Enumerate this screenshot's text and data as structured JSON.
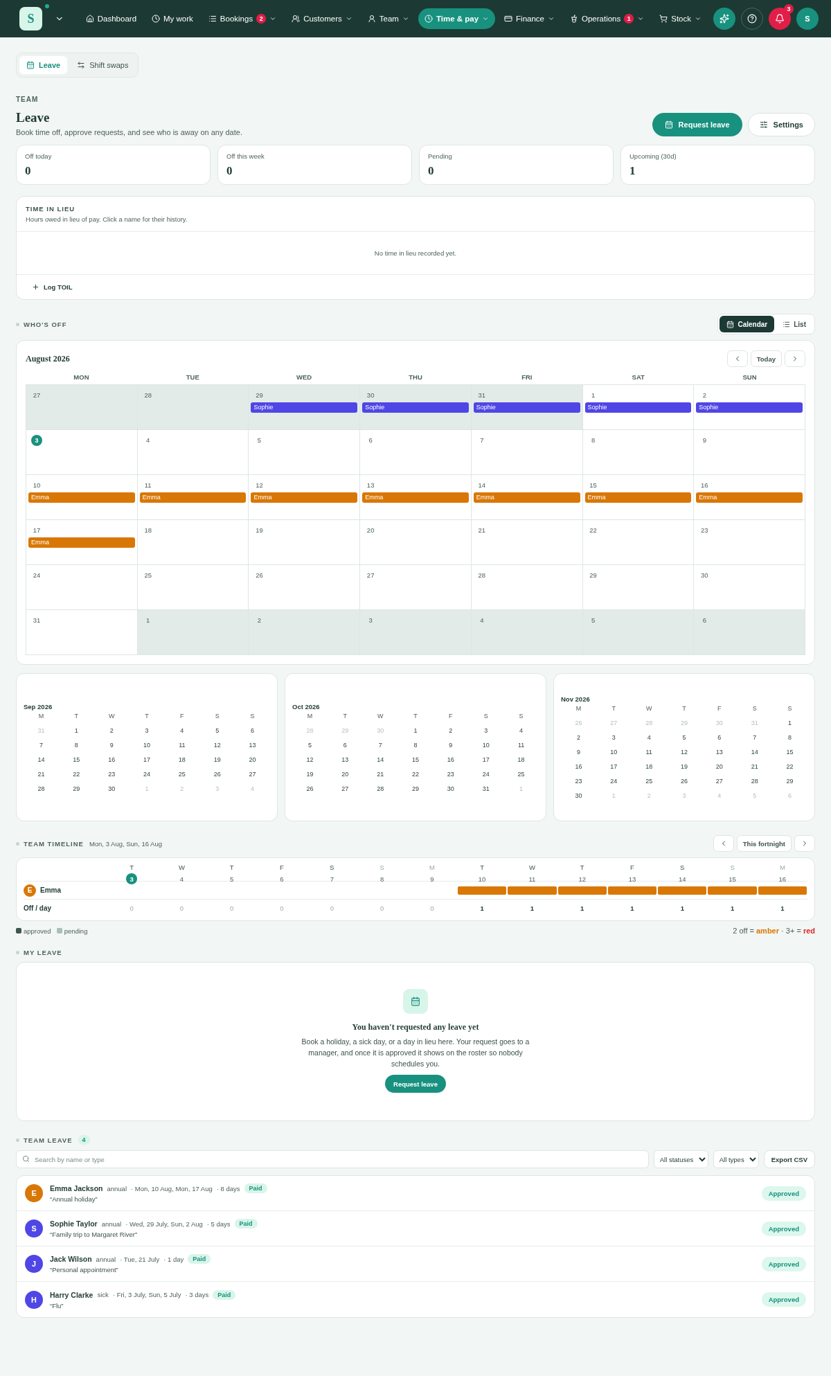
{
  "nav": {
    "logo": "S",
    "items": [
      {
        "label": "Dashboard",
        "selected": false
      },
      {
        "label": "My work",
        "selected": false
      },
      {
        "label": "Bookings",
        "badge": "2",
        "caret": true,
        "selected": false
      },
      {
        "label": "Customers",
        "caret": true,
        "selected": false
      },
      {
        "label": "Team",
        "caret": true,
        "selected": false
      },
      {
        "label": "Time & pay",
        "caret": true,
        "selected": true
      },
      {
        "label": "Finance",
        "caret": true,
        "selected": false
      },
      {
        "label": "Operations",
        "badge": "1",
        "caret": true,
        "selected": false
      },
      {
        "label": "Stock",
        "caret": true,
        "selected": false
      }
    ],
    "notifications": "3",
    "avatar": "S"
  },
  "tabs": [
    {
      "label": "Leave",
      "selected": true
    },
    {
      "label": "Shift swaps",
      "selected": false
    }
  ],
  "header": {
    "eyebrow": "TEAM",
    "title": "Leave",
    "subtitle": "Book time off, approve requests, and see who is away on any date.",
    "primary": "Request leave",
    "secondary": "Settings"
  },
  "stats": [
    {
      "label": "Off today",
      "value": "0"
    },
    {
      "label": "Off this week",
      "value": "0"
    },
    {
      "label": "Pending",
      "value": "0"
    },
    {
      "label": "Upcoming (30d)",
      "value": "1"
    }
  ],
  "lieu": {
    "title": "TIME IN LIEU",
    "subtitle": "Hours owed in lieu of pay. Click a name for their history.",
    "empty": "No time in lieu recorded yet.",
    "action": "Log TOIL"
  },
  "whos_off": {
    "title": "WHO'S OFF",
    "views": [
      {
        "label": "Calendar",
        "selected": true
      },
      {
        "label": "List",
        "selected": false
      }
    ]
  },
  "calendar": {
    "month": "August 2026",
    "today_button": "Today",
    "weekdays": [
      "MON",
      "TUE",
      "WED",
      "THU",
      "FRI",
      "SAT",
      "SUN"
    ],
    "weeks": [
      [
        {
          "day": "27",
          "outside": true,
          "today": false
        },
        {
          "day": "28",
          "outside": true,
          "today": false
        },
        {
          "day": "29",
          "outside": true,
          "today": false,
          "events": [
            {
              "name": "Sophie",
              "color": "#4f46e5"
            }
          ]
        },
        {
          "day": "30",
          "outside": true,
          "today": false,
          "events": [
            {
              "name": "Sophie",
              "color": "#4f46e5"
            }
          ]
        },
        {
          "day": "31",
          "outside": true,
          "today": false,
          "events": [
            {
              "name": "Sophie",
              "color": "#4f46e5"
            }
          ]
        },
        {
          "day": "1",
          "outside": false,
          "today": false,
          "events": [
            {
              "name": "Sophie",
              "color": "#4f46e5"
            }
          ]
        },
        {
          "day": "2",
          "outside": false,
          "today": false,
          "events": [
            {
              "name": "Sophie",
              "color": "#4f46e5"
            }
          ]
        }
      ],
      [
        {
          "day": "3",
          "outside": false,
          "today": true
        },
        {
          "day": "4",
          "outside": false,
          "today": false
        },
        {
          "day": "5",
          "outside": false,
          "today": false
        },
        {
          "day": "6",
          "outside": false,
          "today": false
        },
        {
          "day": "7",
          "outside": false,
          "today": false
        },
        {
          "day": "8",
          "outside": false,
          "today": false
        },
        {
          "day": "9",
          "outside": false,
          "today": false
        }
      ],
      [
        {
          "day": "10",
          "outside": false,
          "today": false,
          "events": [
            {
              "name": "Emma",
              "color": "#d97706"
            }
          ]
        },
        {
          "day": "11",
          "outside": false,
          "today": false,
          "events": [
            {
              "name": "Emma",
              "color": "#d97706"
            }
          ]
        },
        {
          "day": "12",
          "outside": false,
          "today": false,
          "events": [
            {
              "name": "Emma",
              "color": "#d97706"
            }
          ]
        },
        {
          "day": "13",
          "outside": false,
          "today": false,
          "events": [
            {
              "name": "Emma",
              "color": "#d97706"
            }
          ]
        },
        {
          "day": "14",
          "outside": false,
          "today": false,
          "events": [
            {
              "name": "Emma",
              "color": "#d97706"
            }
          ]
        },
        {
          "day": "15",
          "outside": false,
          "today": false,
          "events": [
            {
              "name": "Emma",
              "color": "#d97706"
            }
          ]
        },
        {
          "day": "16",
          "outside": false,
          "today": false,
          "events": [
            {
              "name": "Emma",
              "color": "#d97706"
            }
          ]
        }
      ],
      [
        {
          "day": "17",
          "outside": false,
          "today": false,
          "events": [
            {
              "name": "Emma",
              "color": "#d97706"
            }
          ]
        },
        {
          "day": "18",
          "outside": false,
          "today": false
        },
        {
          "day": "19",
          "outside": false,
          "today": false
        },
        {
          "day": "20",
          "outside": false,
          "today": false
        },
        {
          "day": "21",
          "outside": false,
          "today": false
        },
        {
          "day": "22",
          "outside": false,
          "today": false
        },
        {
          "day": "23",
          "outside": false,
          "today": false
        }
      ],
      [
        {
          "day": "24",
          "outside": false,
          "today": false
        },
        {
          "day": "25",
          "outside": false,
          "today": false
        },
        {
          "day": "26",
          "outside": false,
          "today": false
        },
        {
          "day": "27",
          "outside": false,
          "today": false
        },
        {
          "day": "28",
          "outside": false,
          "today": false
        },
        {
          "day": "29",
          "outside": false,
          "today": false
        },
        {
          "day": "30",
          "outside": false,
          "today": false
        }
      ],
      [
        {
          "day": "31",
          "outside": false,
          "today": false
        },
        {
          "day": "1",
          "outside": true,
          "today": false
        },
        {
          "day": "2",
          "outside": true,
          "today": false
        },
        {
          "day": "3",
          "outside": true,
          "today": false
        },
        {
          "day": "4",
          "outside": true,
          "today": false
        },
        {
          "day": "5",
          "outside": true,
          "today": false
        },
        {
          "day": "6",
          "outside": true,
          "today": false
        }
      ]
    ]
  },
  "mini_calendars": [
    {
      "title": "Sep 2026",
      "weekdays": [
        "M",
        "T",
        "W",
        "T",
        "F",
        "S",
        "S"
      ],
      "prev": [
        "31"
      ],
      "days": [
        "1",
        "2",
        "3",
        "4",
        "5",
        "6",
        "7",
        "8",
        "9",
        "10",
        "11",
        "12",
        "13",
        "14",
        "15",
        "16",
        "17",
        "18",
        "19",
        "20",
        "21",
        "22",
        "23",
        "24",
        "25",
        "26",
        "27",
        "28",
        "29",
        "30"
      ],
      "next": [
        "1",
        "2",
        "3",
        "4"
      ]
    },
    {
      "title": "Oct 2026",
      "weekdays": [
        "M",
        "T",
        "W",
        "T",
        "F",
        "S",
        "S"
      ],
      "prev": [
        "28",
        "29",
        "30"
      ],
      "days": [
        "1",
        "2",
        "3",
        "4",
        "5",
        "6",
        "7",
        "8",
        "9",
        "10",
        "11",
        "12",
        "13",
        "14",
        "15",
        "16",
        "17",
        "18",
        "19",
        "20",
        "21",
        "22",
        "23",
        "24",
        "25",
        "26",
        "27",
        "28",
        "29",
        "30",
        "31"
      ],
      "next": [
        "1"
      ]
    },
    {
      "title": "Nov 2026",
      "weekdays": [
        "M",
        "T",
        "W",
        "T",
        "F",
        "S",
        "S"
      ],
      "prev": [
        "26",
        "27",
        "28",
        "29",
        "30",
        "31"
      ],
      "days": [
        "1",
        "2",
        "3",
        "4",
        "5",
        "6",
        "7",
        "8",
        "9",
        "10",
        "11",
        "12",
        "13",
        "14",
        "15",
        "16",
        "17",
        "18",
        "19",
        "20",
        "21",
        "22",
        "23",
        "24",
        "25",
        "26",
        "27",
        "28",
        "29",
        "30"
      ],
      "next": [
        "1",
        "2",
        "3",
        "4",
        "5",
        "6"
      ]
    }
  ],
  "timeline": {
    "title": "TEAM TIMELINE",
    "range": "Mon, 3 Aug, Sun, 16 Aug",
    "period": "This fortnight",
    "days": [
      {
        "dow": "T",
        "date": "3",
        "today": true,
        "muted": false
      },
      {
        "dow": "W",
        "date": "4",
        "today": false,
        "muted": false
      },
      {
        "dow": "T",
        "date": "5",
        "today": false,
        "muted": false
      },
      {
        "dow": "F",
        "date": "6",
        "today": false,
        "muted": false
      },
      {
        "dow": "S",
        "date": "7",
        "today": false,
        "muted": false
      },
      {
        "dow": "S",
        "date": "8",
        "today": false,
        "muted": true
      },
      {
        "dow": "M",
        "date": "9",
        "today": false,
        "muted": true
      },
      {
        "dow": "T",
        "date": "10",
        "today": false,
        "muted": false
      },
      {
        "dow": "W",
        "date": "11",
        "today": false,
        "muted": false
      },
      {
        "dow": "T",
        "date": "12",
        "today": false,
        "muted": false
      },
      {
        "dow": "F",
        "date": "13",
        "today": false,
        "muted": false
      },
      {
        "dow": "S",
        "date": "14",
        "today": false,
        "muted": false
      },
      {
        "dow": "S",
        "date": "15",
        "today": false,
        "muted": true
      },
      {
        "dow": "M",
        "date": "16",
        "today": false,
        "muted": true
      }
    ],
    "people": [
      {
        "name": "Emma",
        "initial": "E",
        "color": "#d97706",
        "off": [
          false,
          false,
          false,
          false,
          false,
          false,
          false,
          true,
          true,
          true,
          true,
          true,
          true,
          true
        ]
      }
    ],
    "total_label": "Off / day",
    "totals": [
      {
        "value": "0",
        "strong": false
      },
      {
        "value": "0",
        "strong": false
      },
      {
        "value": "0",
        "strong": false
      },
      {
        "value": "0",
        "strong": false
      },
      {
        "value": "0",
        "strong": false
      },
      {
        "value": "0",
        "strong": false
      },
      {
        "value": "0",
        "strong": false
      },
      {
        "value": "1",
        "strong": true
      },
      {
        "value": "1",
        "strong": true
      },
      {
        "value": "1",
        "strong": true
      },
      {
        "value": "1",
        "strong": true
      },
      {
        "value": "1",
        "strong": true
      },
      {
        "value": "1",
        "strong": true
      },
      {
        "value": "1",
        "strong": true
      }
    ],
    "legend": [
      {
        "label": "approved",
        "color": "#3f5550"
      },
      {
        "label": "pending",
        "color": "#a9bfb8"
      }
    ],
    "note": [
      {
        "text": "2 off = "
      },
      {
        "text": "amber",
        "color": "#d97706"
      },
      {
        "text": " · 3+ = "
      },
      {
        "text": "red",
        "color": "#dc2626"
      }
    ]
  },
  "my_leave": {
    "title": "MY LEAVE",
    "empty_title": "You haven't requested any leave yet",
    "empty_text": "Book a holiday, a sick day, or a day in lieu here. Your request goes to a manager, and once it is approved it shows on the roster so nobody schedules you.",
    "button": "Request leave"
  },
  "team_leave": {
    "title": "TEAM LEAVE",
    "count": "4",
    "search_placeholder": "Search by name or type",
    "status_filter": "All statuses",
    "type_filter": "All types",
    "export": "Export CSV",
    "rows": [
      {
        "initial": "E",
        "color": "#d97706",
        "name": "Emma Jackson",
        "type": "annual",
        "dates": "· Mon, 10 Aug, Mon, 17 Aug",
        "days": "· 8 days",
        "pay": "Paid",
        "note": "“Annual holiday”",
        "status": "Approved"
      },
      {
        "initial": "S",
        "color": "#4f46e5",
        "name": "Sophie Taylor",
        "type": "annual",
        "dates": "· Wed, 29 July, Sun, 2 Aug",
        "days": "· 5 days",
        "pay": "Paid",
        "note": "“Family trip to Margaret River”",
        "status": "Approved"
      },
      {
        "initial": "J",
        "color": "#4f46e5",
        "name": "Jack Wilson",
        "type": "annual",
        "dates": "· Tue, 21 July",
        "days": "· 1 day",
        "pay": "Paid",
        "note": "“Personal appointment”",
        "status": "Approved"
      },
      {
        "initial": "H",
        "color": "#4f46e5",
        "name": "Harry Clarke",
        "type": "sick",
        "dates": "· Fri, 3 July, Sun, 5 July",
        "days": "· 3 days",
        "pay": "Paid",
        "note": "“Flu”",
        "status": "Approved"
      }
    ]
  }
}
